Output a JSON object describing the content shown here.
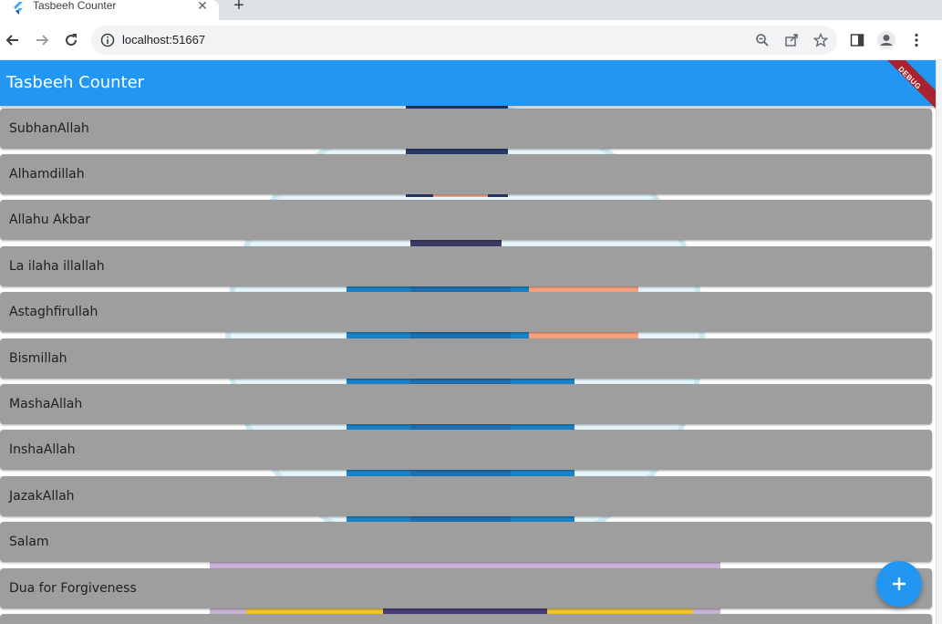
{
  "browser": {
    "tab_title": "Tasbeeh Counter",
    "url": "localhost:51667"
  },
  "app": {
    "title": "Tasbeeh Counter",
    "debug_banner": "DEBUG",
    "accent_color": "#2196f3",
    "item_color": "#9e9e9e"
  },
  "list": {
    "items": [
      {
        "label": "SubhanAllah"
      },
      {
        "label": "Alhamdillah"
      },
      {
        "label": "Allahu Akbar"
      },
      {
        "label": "La ilaha illallah"
      },
      {
        "label": "Astaghfirullah"
      },
      {
        "label": "Bismillah"
      },
      {
        "label": "MashaAllah"
      },
      {
        "label": "InshaAllah"
      },
      {
        "label": "JazakAllah"
      },
      {
        "label": "Salam"
      },
      {
        "label": "Dua for Forgiveness"
      },
      {
        "label": ""
      }
    ]
  },
  "fab": {
    "icon": "plus-icon"
  },
  "icons": {
    "back": "arrow-left-icon",
    "forward": "arrow-right-icon",
    "reload": "reload-icon",
    "info": "info-icon",
    "zoom": "zoom-icon",
    "share": "share-icon",
    "bookmark": "star-icon",
    "side_panel": "side-panel-icon",
    "profile": "profile-icon",
    "menu": "kebab-menu-icon"
  }
}
